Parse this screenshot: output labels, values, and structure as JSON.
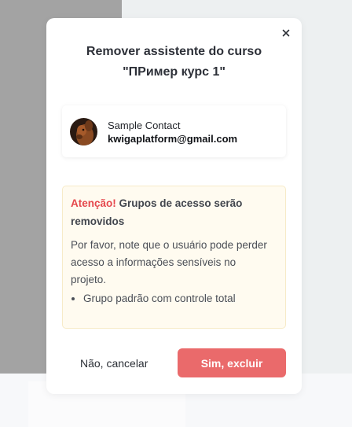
{
  "modal": {
    "title_line1": "Remover assistente do curso",
    "title_line2": "\"ПРимер курс 1\"",
    "close_icon": "close-icon"
  },
  "contact": {
    "name": "Sample Contact",
    "email": "kwigaplatform@gmail.com",
    "avatar_icon": "avatar"
  },
  "warning": {
    "accent": "Atenção!",
    "heading": "Grupos de acesso serão removidos",
    "body": "Por favor, note que o usuário pode perder acesso a informações sensíveis no projeto.",
    "items": [
      "Grupo padrão com controle total"
    ]
  },
  "actions": {
    "cancel_label": "Não, cancelar",
    "confirm_label": "Sim, excluir"
  },
  "colors": {
    "danger": "#ea6a6b",
    "accent_text": "#e5484d",
    "warning_bg": "#fffbf0",
    "warning_border": "#f7ebc8"
  }
}
